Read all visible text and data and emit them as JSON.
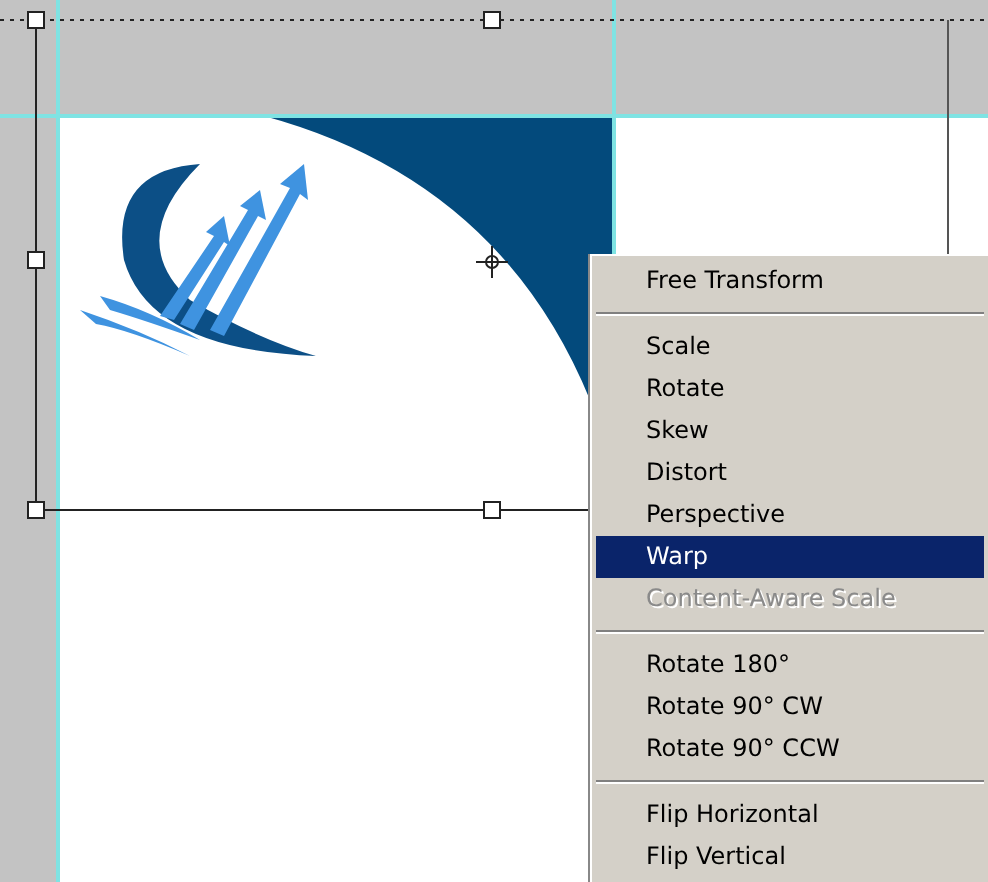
{
  "context_menu": {
    "groups": [
      {
        "items": [
          {
            "label": "Free Transform",
            "selected": false,
            "disabled": false
          }
        ]
      },
      {
        "items": [
          {
            "label": "Scale",
            "selected": false,
            "disabled": false
          },
          {
            "label": "Rotate",
            "selected": false,
            "disabled": false
          },
          {
            "label": "Skew",
            "selected": false,
            "disabled": false
          },
          {
            "label": "Distort",
            "selected": false,
            "disabled": false
          },
          {
            "label": "Perspective",
            "selected": false,
            "disabled": false
          },
          {
            "label": "Warp",
            "selected": true,
            "disabled": false
          },
          {
            "label": "Content-Aware Scale",
            "selected": false,
            "disabled": true
          }
        ]
      },
      {
        "items": [
          {
            "label": "Rotate 180°",
            "selected": false,
            "disabled": false
          },
          {
            "label": "Rotate 90° CW",
            "selected": false,
            "disabled": false
          },
          {
            "label": "Rotate 90° CCW",
            "selected": false,
            "disabled": false
          }
        ]
      },
      {
        "items": [
          {
            "label": "Flip Horizontal",
            "selected": false,
            "disabled": false
          },
          {
            "label": "Flip Vertical",
            "selected": false,
            "disabled": false
          }
        ]
      }
    ]
  }
}
